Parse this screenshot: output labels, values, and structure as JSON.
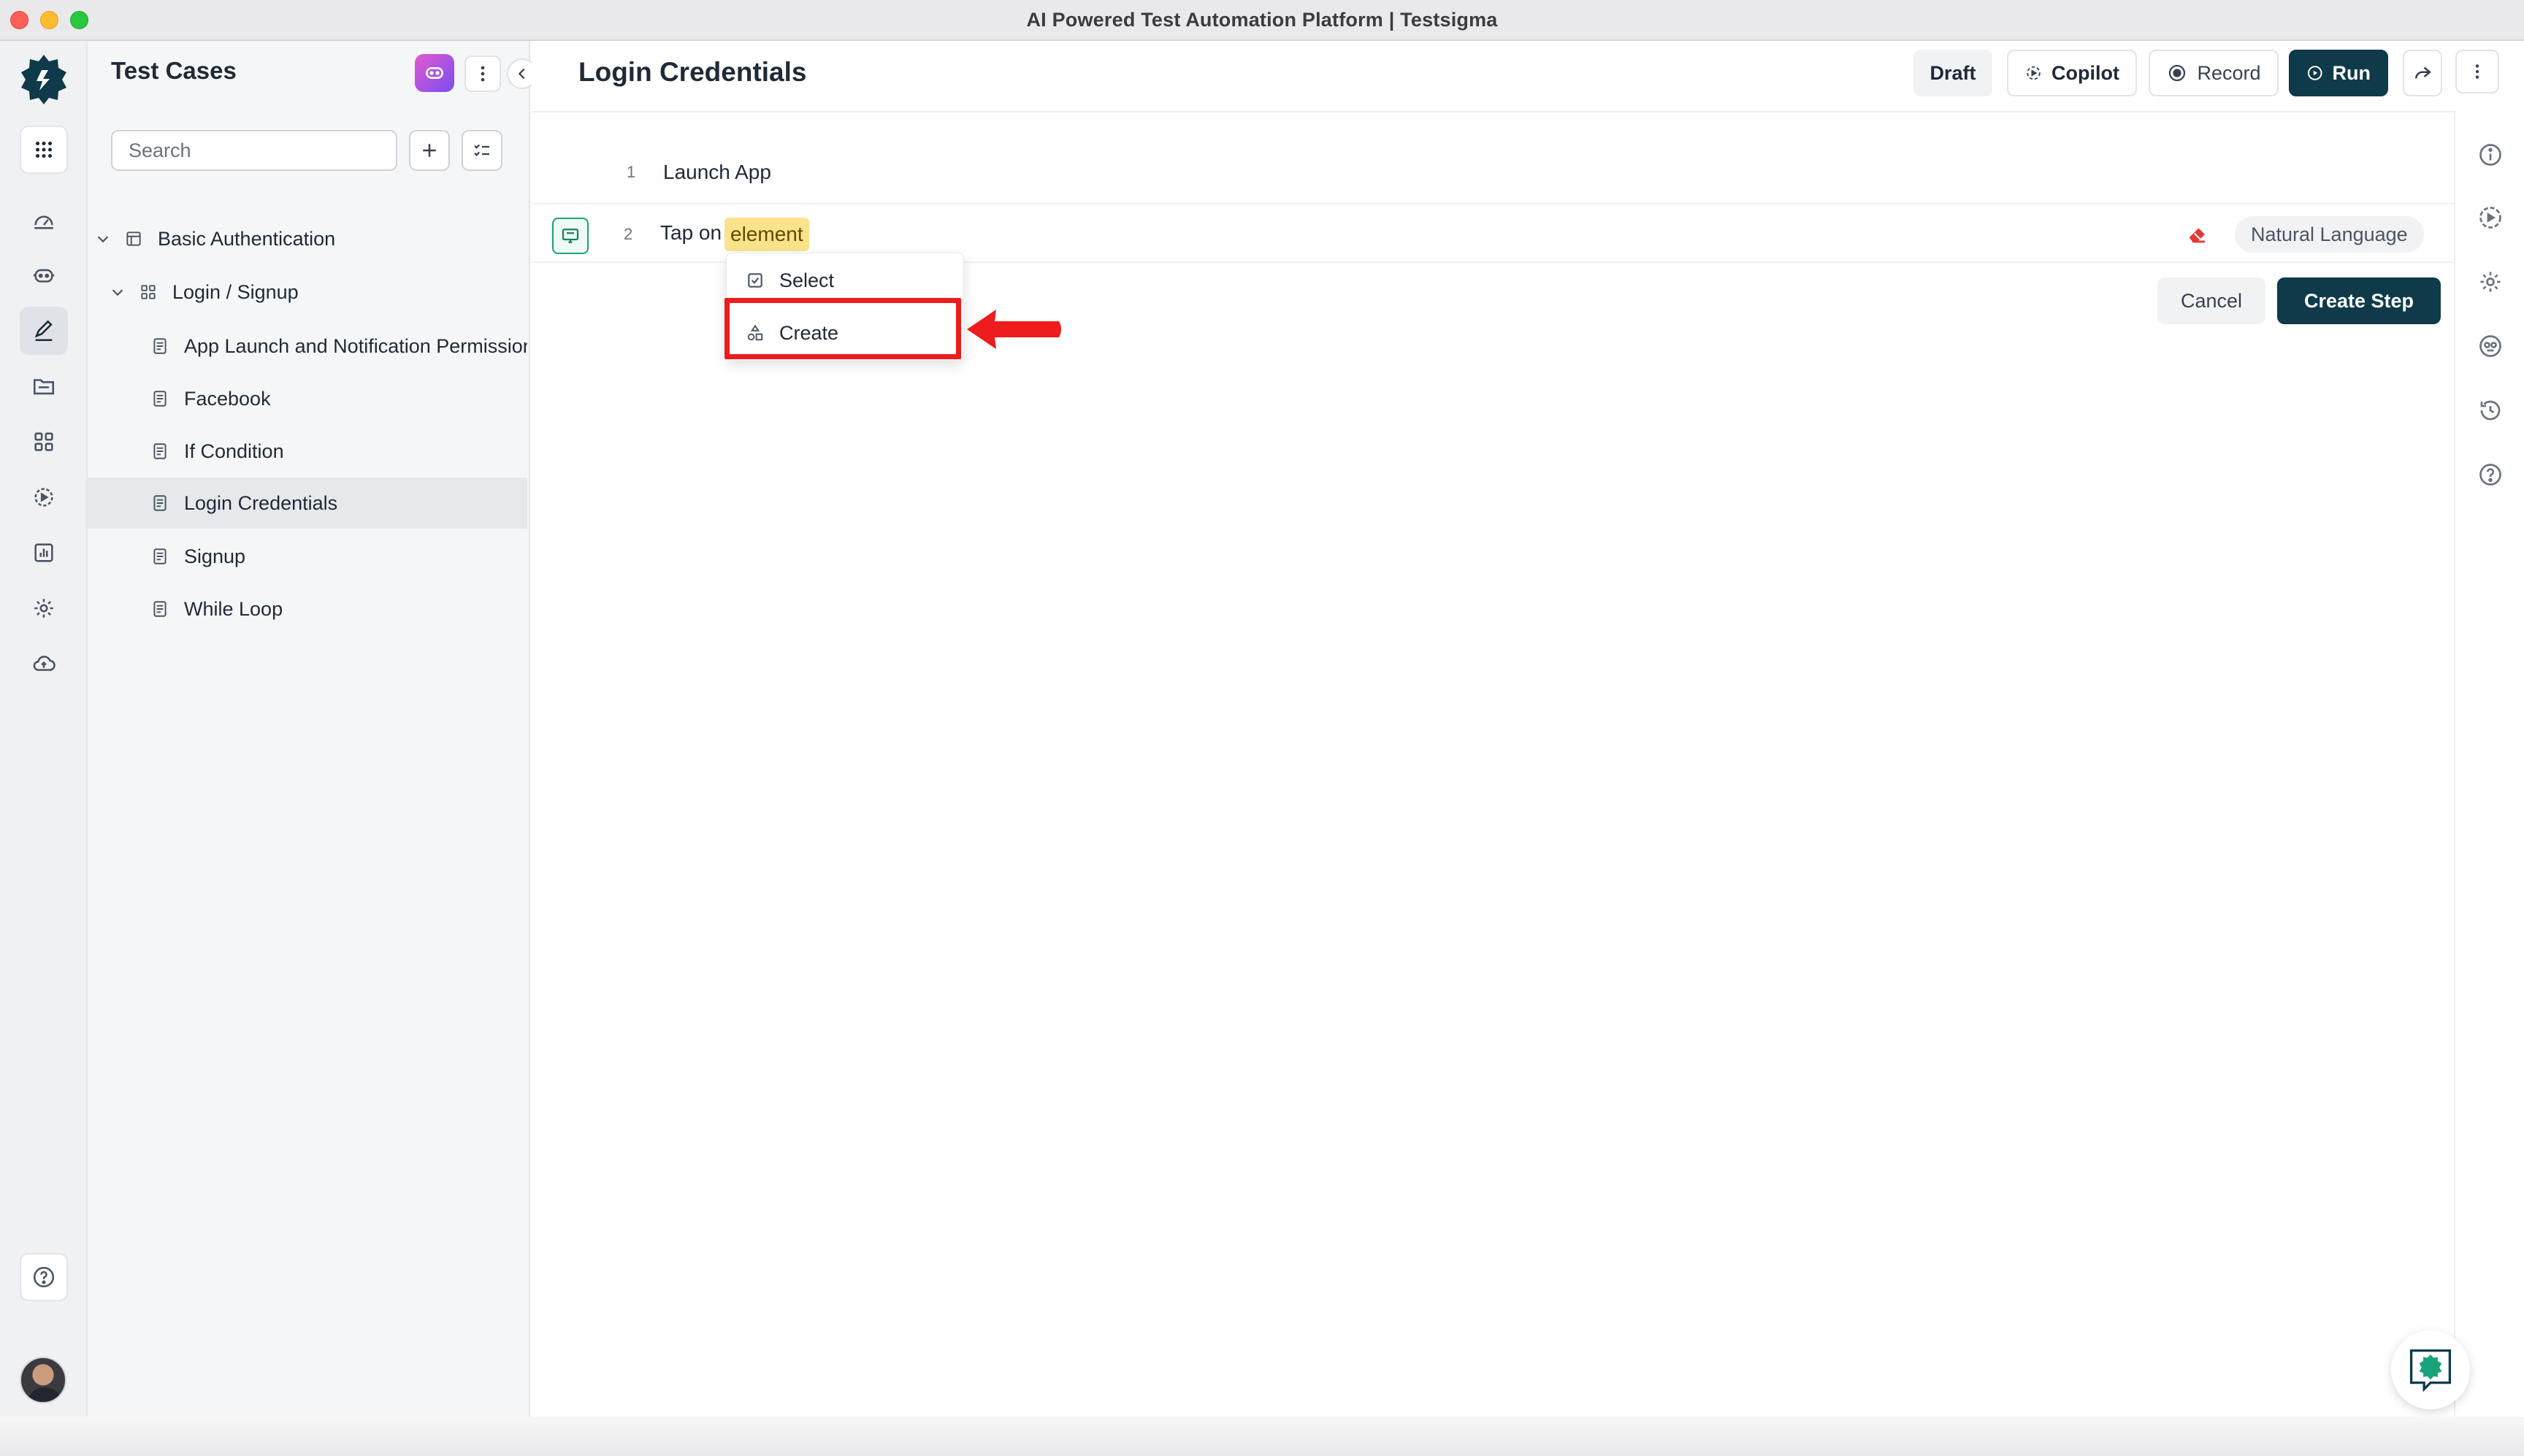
{
  "window": {
    "title": "AI Powered Test Automation Platform | Testsigma"
  },
  "rail": {
    "icons": [
      "logo-icon",
      "grid-apps-icon",
      "dashboard-icon",
      "copilot-bot-icon",
      "edit-test-cases-icon",
      "folder-icon",
      "elements-icon",
      "test-runs-icon",
      "reports-icon",
      "settings-icon",
      "cloud-upload-icon",
      "help-icon",
      "avatar"
    ]
  },
  "sidebar": {
    "title": "Test Cases",
    "search_placeholder": "Search",
    "tree": [
      {
        "label": "Basic Authentication",
        "type": "suite-folder",
        "expanded": true
      },
      {
        "label": "Login / Signup",
        "type": "group",
        "expanded": true
      },
      {
        "label": "App Launch and Notification Permission",
        "type": "test-case"
      },
      {
        "label": "Facebook",
        "type": "test-case"
      },
      {
        "label": "If Condition",
        "type": "test-case"
      },
      {
        "label": "Login Credentials",
        "type": "test-case",
        "selected": true
      },
      {
        "label": "Signup",
        "type": "test-case"
      },
      {
        "label": "While Loop",
        "type": "test-case"
      }
    ]
  },
  "header": {
    "title": "Login Credentials",
    "buttons": {
      "draft": "Draft",
      "copilot": "Copilot",
      "record": "Record",
      "run": "Run"
    }
  },
  "steps": [
    {
      "number": "1",
      "text": "Launch App"
    },
    {
      "number": "2",
      "prefix": "Tap on",
      "placeholder": "element",
      "mode": "Natural Language"
    }
  ],
  "element_menu": {
    "options": [
      "Select",
      "Create"
    ],
    "highlighted": "Create"
  },
  "actions": {
    "cancel": "Cancel",
    "create_step": "Create Step"
  },
  "colors": {
    "primary": "#0e3a4a",
    "accent_green": "#1aa37a",
    "highlight_red": "#ee1c1c",
    "chip_yellow": "#fbe38b"
  }
}
